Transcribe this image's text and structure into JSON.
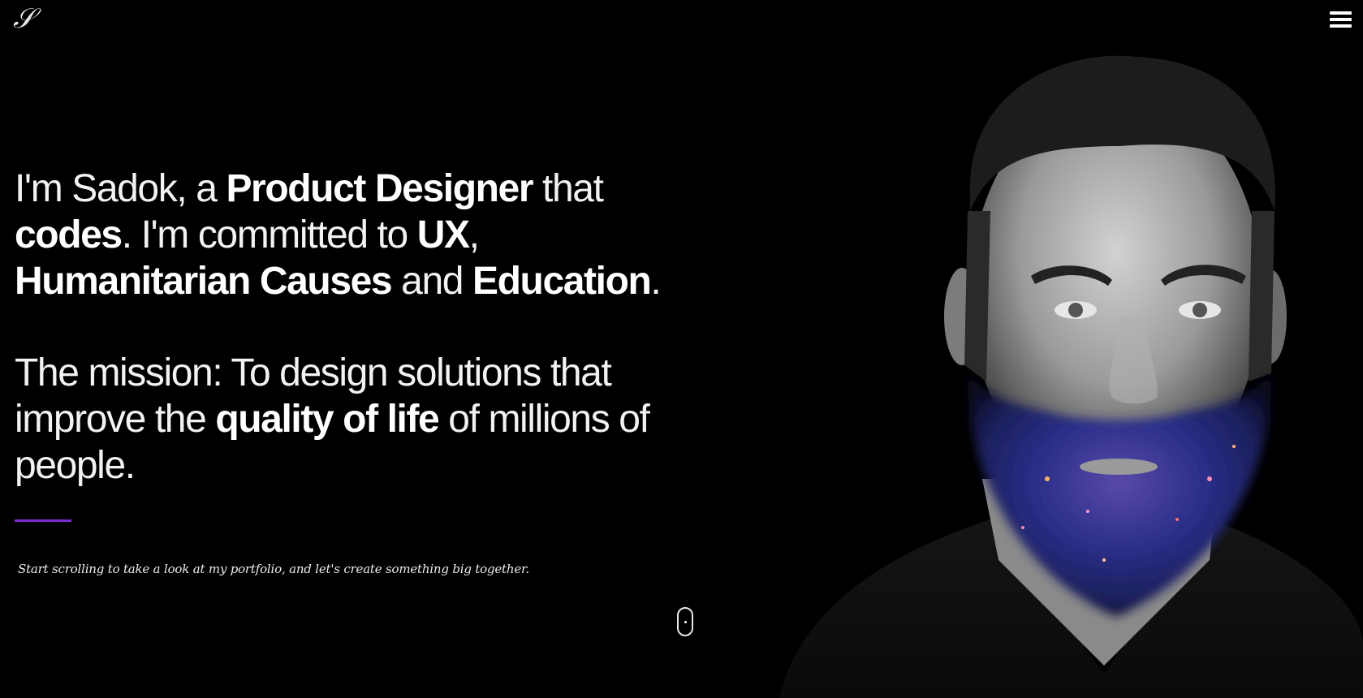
{
  "header": {
    "logo_text": "𝒮",
    "menu_icon": "hamburger-menu-icon"
  },
  "hero": {
    "intro": [
      {
        "t": "I'm Sadok, a ",
        "b": false
      },
      {
        "t": "Product Designer",
        "b": true
      },
      {
        "t": " that ",
        "b": false
      },
      {
        "t": "codes",
        "b": true
      },
      {
        "t": ". I'm committed to ",
        "b": false
      },
      {
        "t": "UX",
        "b": true
      },
      {
        "t": ", ",
        "b": false
      },
      {
        "t": "Humanitarian Causes",
        "b": true
      },
      {
        "t": " and ",
        "b": false
      },
      {
        "t": "Education",
        "b": true
      },
      {
        "t": ".",
        "b": false
      }
    ],
    "mission": [
      {
        "t": "The mission: To design solutions that improve the ",
        "b": false
      },
      {
        "t": "quality of life",
        "b": true
      },
      {
        "t": " of millions of people.",
        "b": false
      }
    ],
    "tagline": "Start scrolling to take a look at my portfolio, and let's create something big together."
  },
  "scroll_indicator": {
    "icon": "scroll-mouse-icon"
  },
  "colors": {
    "background": "#000000",
    "accent": "#7a2ad2",
    "text": "#ffffff"
  }
}
